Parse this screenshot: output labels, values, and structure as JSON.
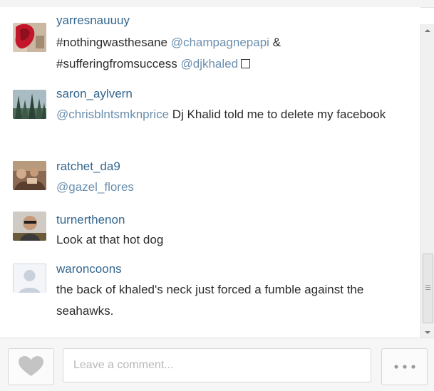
{
  "comments": [
    {
      "username": "yarresnauuuy",
      "avatar_icon": "user-photo-red",
      "text_parts": [
        "#nothingwasthesane ",
        "@champagnepapi",
        " &",
        "#sufferingfromsuccess ",
        "@djkhaled"
      ]
    },
    {
      "username": "saron_aylvern",
      "avatar_icon": "user-photo-forest",
      "mention": "@chrisblntsmknprice",
      "text": " Dj Khalid told me to delete my facebook"
    },
    {
      "username": "ratchet_da9",
      "avatar_icon": "user-photo-group",
      "mention": "@gazel_flores"
    },
    {
      "username": "turnerthenon",
      "avatar_icon": "user-photo-person",
      "text": "Look at that hot dog"
    },
    {
      "username": "waroncoons",
      "avatar_icon": "default-avatar",
      "text": "the back of khaled's neck just forced a fumble against the seahawks."
    }
  ],
  "footer": {
    "like_icon": "heart-icon",
    "comment_placeholder": "Leave a comment...",
    "more_icon": "ellipsis-icon"
  },
  "colors": {
    "username": "#34678f",
    "mention": "#6b8fae",
    "text": "#2b2b2b"
  }
}
